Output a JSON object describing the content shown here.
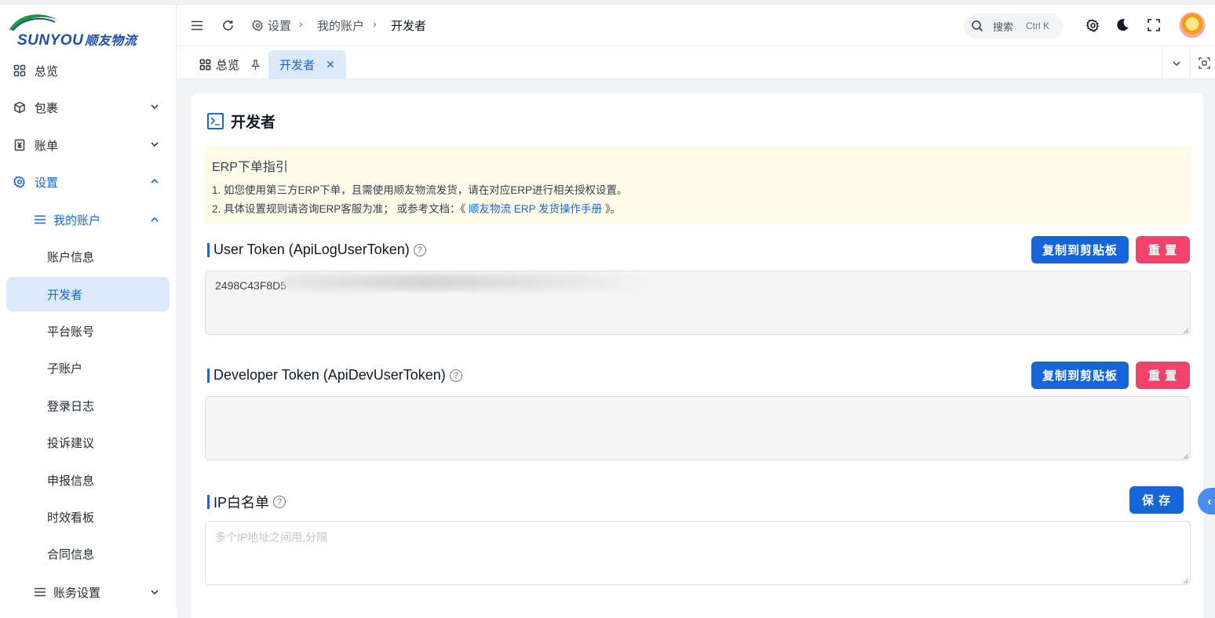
{
  "brand": {
    "logo_latin": "SUNYOU",
    "logo_cn": "顺友物流"
  },
  "sidebar": {
    "items": [
      {
        "label": "总览",
        "icon": "dashboard-icon"
      },
      {
        "label": "包裹",
        "icon": "package-icon"
      },
      {
        "label": "账单",
        "icon": "bill-icon"
      },
      {
        "label": "设置",
        "icon": "gear-icon"
      }
    ],
    "my_account": "我的账户",
    "leaves": [
      "账户信息",
      "开发者",
      "平台账号",
      "子账户",
      "登录日志",
      "投诉建议",
      "申报信息",
      "时效看板",
      "合同信息"
    ],
    "finance_settings": "账务设置"
  },
  "header": {
    "breadcrumb": [
      "设置",
      "我的账户",
      "开发者"
    ],
    "search_label": "搜索",
    "search_shortcut": "Ctrl K"
  },
  "tabs": [
    {
      "label": "总览"
    },
    {
      "label": "开发者"
    }
  ],
  "page": {
    "title": "开发者",
    "guide": {
      "heading": "ERP下单指引",
      "line1": "1. 如您使用第三方ERP下单，且需使用顺友物流发货，请在对应ERP进行相关授权设置。",
      "line2_prefix": "2. 具体设置规则请咨询ERP客服为准；  或参考文档：《",
      "line2_link": " 顺友物流 ERP 发货操作手册 ",
      "line2_suffix": "》。"
    },
    "user_token": {
      "title": "User Token (ApiLogUserToken)",
      "value": "2498C43F8D5",
      "copy": "复制到剪贴板",
      "reset": "重 置"
    },
    "dev_token": {
      "title": "Developer Token (ApiDevUserToken)",
      "value": "",
      "copy": "复制到剪贴板",
      "reset": "重 置"
    },
    "ip_whitelist": {
      "title": "IP白名单",
      "placeholder": "多个IP地址之间用,分隔",
      "save": "保 存"
    }
  },
  "colors": {
    "primary": "#1868d8",
    "danger": "#f0426b",
    "active_bg": "#dbe9fb",
    "notice_bg": "#fefce8"
  }
}
